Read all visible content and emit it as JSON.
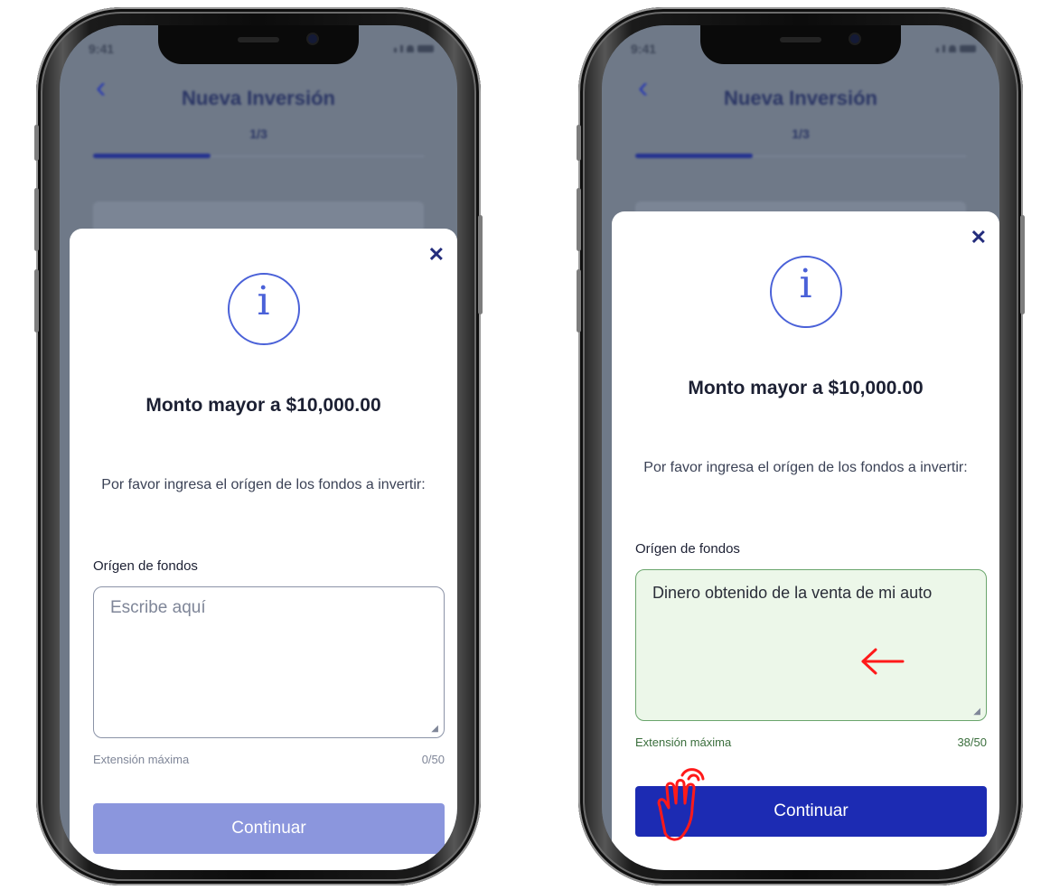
{
  "status": {
    "time": "9:41"
  },
  "nav": {
    "title": "Nueva Inversión",
    "step": "1/3",
    "progress": 0.33
  },
  "modal": {
    "close": "✕",
    "info_glyph": "i",
    "title": "Monto mayor a $10,000.00",
    "message": "Por favor ingresa el orígen de los fondos a invertir:",
    "field_label": "Orígen de fondos",
    "placeholder": "Escribe aquí",
    "helper": "Extensión máxima",
    "continue_label": "Continuar"
  },
  "left_screen": {
    "state": "empty",
    "counter": "0/50",
    "button_state": "disabled"
  },
  "right_screen": {
    "state": "filled",
    "field_value": "Dinero obtenido de la venta de mi auto",
    "counter": "38/50",
    "button_state": "enabled"
  },
  "annotations": {
    "arrow_color": "#ff1a1a",
    "hand_cursor_color": "#ff1a1a"
  },
  "colors": {
    "primary": "#1c2bb3",
    "primary_disabled": "#8b96dd",
    "info_blue": "#4a61d8",
    "success_border": "#6aa56c",
    "success_bg": "#ecf7e9"
  }
}
